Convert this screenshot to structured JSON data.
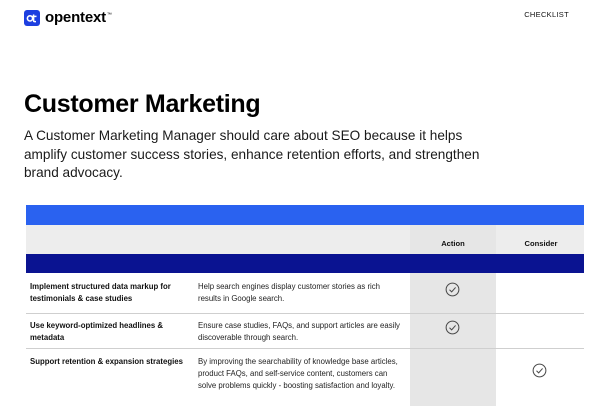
{
  "brand": {
    "name": "opentext",
    "trademark": "™",
    "logo_glyph": "ot"
  },
  "header": {
    "doc_type": "CHECKLIST"
  },
  "title": "Customer Marketing",
  "intro": "A Customer Marketing Manager should care about SEO because it helps amplify customer success stories, enhance retention efforts, and strengthen brand advocacy.",
  "table": {
    "columns": {
      "action": "Action",
      "consider": "Consider"
    },
    "rows": [
      {
        "item": "Implement structured data markup for testimonials & case studies",
        "description": "Help search engines display customer stories as rich results in Google search.",
        "marked": "action"
      },
      {
        "item": "Use keyword-optimized headlines & metadata",
        "description": "Ensure case studies, FAQs, and support articles are easily discoverable through search.",
        "marked": "action"
      },
      {
        "item": "Support retention & expansion strategies",
        "description": "By improving the searchability of knowledge base articles, product FAQs, and self-service content, customers can solve problems quickly - boosting satisfaction and loyalty.",
        "marked": "consider"
      }
    ]
  },
  "colors": {
    "brand_blue": "#2a62f0",
    "navy": "#0a1391",
    "logo_blue": "#1d3fe0"
  }
}
